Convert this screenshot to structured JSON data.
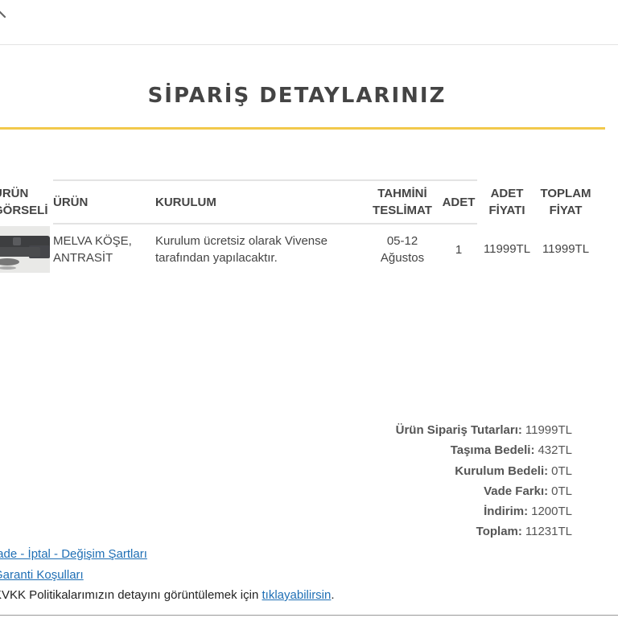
{
  "header": {
    "back_icon": "chevron-left-icon"
  },
  "page": {
    "title": "SİPARİŞ DETAYLARINIZ",
    "accent_color": "#f2c94c"
  },
  "table": {
    "headers": {
      "image_line1": "ÜRÜN",
      "image_line2": "GÖRSELİ",
      "product": "ÜRÜN",
      "assembly": "KURULUM",
      "delivery_line1": "TAHMİNİ",
      "delivery_line2": "TESLİMAT",
      "quantity": "ADET",
      "unit_price_line1": "ADET",
      "unit_price_line2": "FİYATI",
      "total_price_line1": "TOPLAM",
      "total_price_line2": "FİYAT"
    },
    "rows": [
      {
        "product_line1": "MELVA KÖŞE,",
        "product_line2": "ANTRASİT",
        "assembly_line1": "Kurulum ücretsiz olarak Vivense",
        "assembly_line2": "tarafından yapılacaktır.",
        "delivery_line1": "05-12",
        "delivery_line2": "Ağustos",
        "quantity": "1",
        "unit_price": "11999TL",
        "total_price": "11999TL"
      }
    ]
  },
  "summary": {
    "items": [
      {
        "label": "Ürün Sipariş Tutarları:",
        "value": "11999TL"
      },
      {
        "label": "Taşıma Bedeli:",
        "value": "432TL"
      },
      {
        "label": "Kurulum Bedeli:",
        "value": "0TL"
      },
      {
        "label": "Vade Farkı:",
        "value": "0TL"
      },
      {
        "label": "İndirim:",
        "value": "1200TL"
      },
      {
        "label": "Toplam:",
        "value": "11231TL"
      }
    ]
  },
  "footer": {
    "link_returns": "İade - İptal - Değişim Şartları",
    "link_warranty": "Garanti Koşulları",
    "kvkk_text": "KVKK Politikalarımızın detayını görüntülemek için ",
    "kvkk_link": "tıklayabilirsin",
    "kvkk_end": "."
  }
}
